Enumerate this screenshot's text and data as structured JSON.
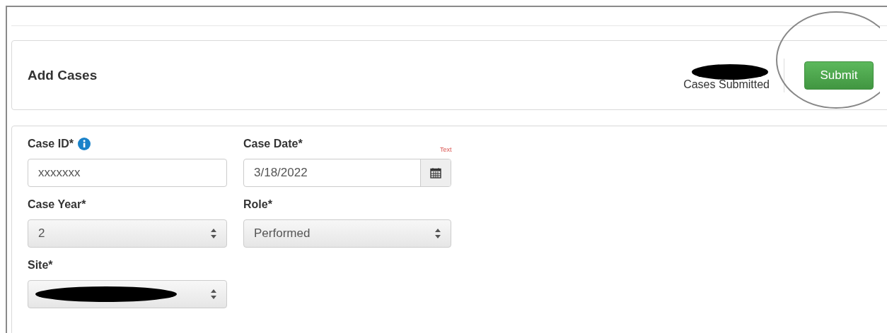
{
  "header": {
    "title": "Add Cases",
    "counter_label": "Cases Submitted",
    "counter_redacted": true,
    "submit": "Submit",
    "submit_circled": true
  },
  "form": {
    "rows": [
      {
        "fields": [
          {
            "kind": "text",
            "label": "Case ID*",
            "info": true,
            "value": "xxxxxxx"
          },
          {
            "kind": "date",
            "label": "Case Date*",
            "value": "3/18/2022",
            "note": "Text"
          }
        ]
      },
      {
        "fields": [
          {
            "kind": "select",
            "label": "Case Year*",
            "value": "2"
          },
          {
            "kind": "select",
            "label": "Role*",
            "value": "Performed"
          }
        ]
      },
      {
        "fields": [
          {
            "kind": "select",
            "label": "Site*",
            "redacted": true
          }
        ]
      }
    ]
  }
}
